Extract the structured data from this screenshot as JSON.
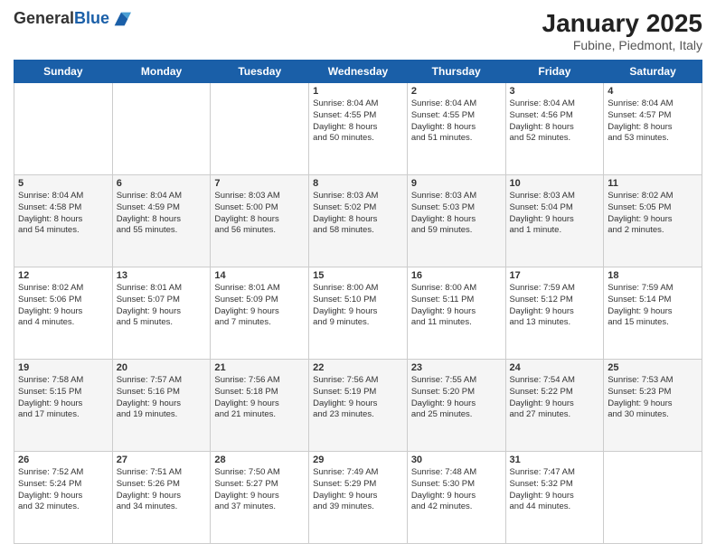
{
  "logo": {
    "general": "General",
    "blue": "Blue"
  },
  "title": "January 2025",
  "subtitle": "Fubine, Piedmont, Italy",
  "days_header": [
    "Sunday",
    "Monday",
    "Tuesday",
    "Wednesday",
    "Thursday",
    "Friday",
    "Saturday"
  ],
  "weeks": [
    [
      {
        "day": "",
        "info": ""
      },
      {
        "day": "",
        "info": ""
      },
      {
        "day": "",
        "info": ""
      },
      {
        "day": "1",
        "info": "Sunrise: 8:04 AM\nSunset: 4:55 PM\nDaylight: 8 hours\nand 50 minutes."
      },
      {
        "day": "2",
        "info": "Sunrise: 8:04 AM\nSunset: 4:55 PM\nDaylight: 8 hours\nand 51 minutes."
      },
      {
        "day": "3",
        "info": "Sunrise: 8:04 AM\nSunset: 4:56 PM\nDaylight: 8 hours\nand 52 minutes."
      },
      {
        "day": "4",
        "info": "Sunrise: 8:04 AM\nSunset: 4:57 PM\nDaylight: 8 hours\nand 53 minutes."
      }
    ],
    [
      {
        "day": "5",
        "info": "Sunrise: 8:04 AM\nSunset: 4:58 PM\nDaylight: 8 hours\nand 54 minutes."
      },
      {
        "day": "6",
        "info": "Sunrise: 8:04 AM\nSunset: 4:59 PM\nDaylight: 8 hours\nand 55 minutes."
      },
      {
        "day": "7",
        "info": "Sunrise: 8:03 AM\nSunset: 5:00 PM\nDaylight: 8 hours\nand 56 minutes."
      },
      {
        "day": "8",
        "info": "Sunrise: 8:03 AM\nSunset: 5:02 PM\nDaylight: 8 hours\nand 58 minutes."
      },
      {
        "day": "9",
        "info": "Sunrise: 8:03 AM\nSunset: 5:03 PM\nDaylight: 8 hours\nand 59 minutes."
      },
      {
        "day": "10",
        "info": "Sunrise: 8:03 AM\nSunset: 5:04 PM\nDaylight: 9 hours\nand 1 minute."
      },
      {
        "day": "11",
        "info": "Sunrise: 8:02 AM\nSunset: 5:05 PM\nDaylight: 9 hours\nand 2 minutes."
      }
    ],
    [
      {
        "day": "12",
        "info": "Sunrise: 8:02 AM\nSunset: 5:06 PM\nDaylight: 9 hours\nand 4 minutes."
      },
      {
        "day": "13",
        "info": "Sunrise: 8:01 AM\nSunset: 5:07 PM\nDaylight: 9 hours\nand 5 minutes."
      },
      {
        "day": "14",
        "info": "Sunrise: 8:01 AM\nSunset: 5:09 PM\nDaylight: 9 hours\nand 7 minutes."
      },
      {
        "day": "15",
        "info": "Sunrise: 8:00 AM\nSunset: 5:10 PM\nDaylight: 9 hours\nand 9 minutes."
      },
      {
        "day": "16",
        "info": "Sunrise: 8:00 AM\nSunset: 5:11 PM\nDaylight: 9 hours\nand 11 minutes."
      },
      {
        "day": "17",
        "info": "Sunrise: 7:59 AM\nSunset: 5:12 PM\nDaylight: 9 hours\nand 13 minutes."
      },
      {
        "day": "18",
        "info": "Sunrise: 7:59 AM\nSunset: 5:14 PM\nDaylight: 9 hours\nand 15 minutes."
      }
    ],
    [
      {
        "day": "19",
        "info": "Sunrise: 7:58 AM\nSunset: 5:15 PM\nDaylight: 9 hours\nand 17 minutes."
      },
      {
        "day": "20",
        "info": "Sunrise: 7:57 AM\nSunset: 5:16 PM\nDaylight: 9 hours\nand 19 minutes."
      },
      {
        "day": "21",
        "info": "Sunrise: 7:56 AM\nSunset: 5:18 PM\nDaylight: 9 hours\nand 21 minutes."
      },
      {
        "day": "22",
        "info": "Sunrise: 7:56 AM\nSunset: 5:19 PM\nDaylight: 9 hours\nand 23 minutes."
      },
      {
        "day": "23",
        "info": "Sunrise: 7:55 AM\nSunset: 5:20 PM\nDaylight: 9 hours\nand 25 minutes."
      },
      {
        "day": "24",
        "info": "Sunrise: 7:54 AM\nSunset: 5:22 PM\nDaylight: 9 hours\nand 27 minutes."
      },
      {
        "day": "25",
        "info": "Sunrise: 7:53 AM\nSunset: 5:23 PM\nDaylight: 9 hours\nand 30 minutes."
      }
    ],
    [
      {
        "day": "26",
        "info": "Sunrise: 7:52 AM\nSunset: 5:24 PM\nDaylight: 9 hours\nand 32 minutes."
      },
      {
        "day": "27",
        "info": "Sunrise: 7:51 AM\nSunset: 5:26 PM\nDaylight: 9 hours\nand 34 minutes."
      },
      {
        "day": "28",
        "info": "Sunrise: 7:50 AM\nSunset: 5:27 PM\nDaylight: 9 hours\nand 37 minutes."
      },
      {
        "day": "29",
        "info": "Sunrise: 7:49 AM\nSunset: 5:29 PM\nDaylight: 9 hours\nand 39 minutes."
      },
      {
        "day": "30",
        "info": "Sunrise: 7:48 AM\nSunset: 5:30 PM\nDaylight: 9 hours\nand 42 minutes."
      },
      {
        "day": "31",
        "info": "Sunrise: 7:47 AM\nSunset: 5:32 PM\nDaylight: 9 hours\nand 44 minutes."
      },
      {
        "day": "",
        "info": ""
      }
    ]
  ]
}
